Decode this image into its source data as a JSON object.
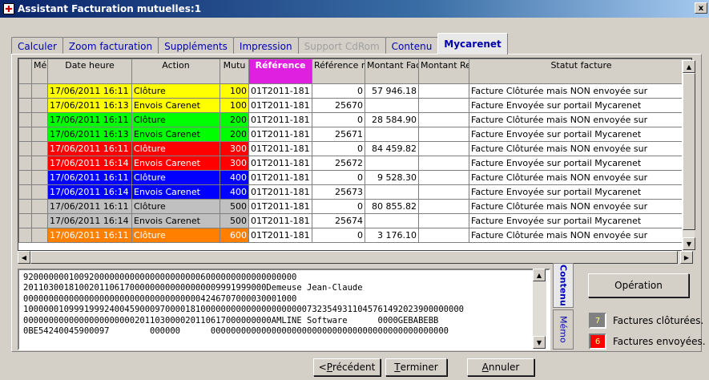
{
  "window": {
    "title": "Assistant Facturation mutuelles:1",
    "icon": "app-cross-icon",
    "close": "x"
  },
  "tabs": [
    {
      "label": "Calculer",
      "state": "normal"
    },
    {
      "label": "Zoom facturation",
      "state": "normal"
    },
    {
      "label": "Suppléments",
      "state": "normal"
    },
    {
      "label": "Impression",
      "state": "normal"
    },
    {
      "label": "Support CdRom",
      "state": "disabled"
    },
    {
      "label": "Contenu",
      "state": "normal"
    },
    {
      "label": "Mycarenet",
      "state": "active"
    }
  ],
  "grid": {
    "headers": [
      "Mé mo",
      "Date heure",
      "Action",
      "Mutu",
      "Référence",
      "Référence retounée",
      "Montant Facture",
      "Montant Rejeté",
      "Statut facture"
    ],
    "rows": [
      {
        "date": "17/06/2011 16:11",
        "action": "Clôture",
        "mutu": "100",
        "ref": "01T2011-181",
        "ref_ret": "0",
        "montant": "57 946.18",
        "rejete": "",
        "statut": "Facture Clôturée mais NON envoyée sur",
        "color": "#ffff00",
        "text": "#000000"
      },
      {
        "date": "17/06/2011 16:13",
        "action": "Envois Carenet",
        "mutu": "100",
        "ref": "01T2011-181",
        "ref_ret": "25670",
        "montant": "",
        "rejete": "",
        "statut": "Facture Envoyée sur portail Mycarenet",
        "color": "#ffff00",
        "text": "#000000"
      },
      {
        "date": "17/06/2011 16:11",
        "action": "Clôture",
        "mutu": "200",
        "ref": "01T2011-181",
        "ref_ret": "0",
        "montant": "28 584.90",
        "rejete": "",
        "statut": "Facture Clôturée mais NON envoyée sur",
        "color": "#00ff00",
        "text": "#000000"
      },
      {
        "date": "17/06/2011 16:13",
        "action": "Envois Carenet",
        "mutu": "200",
        "ref": "01T2011-181",
        "ref_ret": "25671",
        "montant": "",
        "rejete": "",
        "statut": "Facture Envoyée sur portail Mycarenet",
        "color": "#00ff00",
        "text": "#000000"
      },
      {
        "date": "17/06/2011 16:11",
        "action": "Clôture",
        "mutu": "300",
        "ref": "01T2011-181",
        "ref_ret": "0",
        "montant": "84 459.82",
        "rejete": "",
        "statut": "Facture Clôturée mais NON envoyée sur",
        "color": "#ff0000",
        "text": "#ffffff"
      },
      {
        "date": "17/06/2011 16:14",
        "action": "Envois Carenet",
        "mutu": "300",
        "ref": "01T2011-181",
        "ref_ret": "25672",
        "montant": "",
        "rejete": "",
        "statut": "Facture Envoyée sur portail Mycarenet",
        "color": "#ff0000",
        "text": "#ffffff"
      },
      {
        "date": "17/06/2011 16:11",
        "action": "Clôture",
        "mutu": "400",
        "ref": "01T2011-181",
        "ref_ret": "0",
        "montant": "9 528.30",
        "rejete": "",
        "statut": "Facture Clôturée mais NON envoyée sur",
        "color": "#0000ff",
        "text": "#ffffff"
      },
      {
        "date": "17/06/2011 16:14",
        "action": "Envois Carenet",
        "mutu": "400",
        "ref": "01T2011-181",
        "ref_ret": "25673",
        "montant": "",
        "rejete": "",
        "statut": "Facture Envoyée sur portail Mycarenet",
        "color": "#0000ff",
        "text": "#ffffff"
      },
      {
        "date": "17/06/2011 16:11",
        "action": "Clôture",
        "mutu": "500",
        "ref": "01T2011-181",
        "ref_ret": "0",
        "montant": "80 855.82",
        "rejete": "",
        "statut": "Facture Clôturée mais NON envoyée sur",
        "color": "#c0c0c0",
        "text": "#000000"
      },
      {
        "date": "17/06/2011 16:14",
        "action": "Envois Carenet",
        "mutu": "500",
        "ref": "01T2011-181",
        "ref_ret": "25674",
        "montant": "",
        "rejete": "",
        "statut": "Facture Envoyée sur portail Mycarenet",
        "color": "#c0c0c0",
        "text": "#000000"
      },
      {
        "date": "17/06/2011 16:11",
        "action": "Clôture",
        "mutu": "600",
        "ref": "01T2011-181",
        "ref_ret": "0",
        "montant": "3 176.10",
        "rejete": "",
        "statut": "Facture Clôturée mais NON envoyée sur",
        "color": "#ff8000",
        "text": "#ffffff"
      }
    ]
  },
  "content_text": [
    "920000000100920000000000000000000006000000000000000000",
    "201103001810020110617000000000000000009991999000Demeuse Jean-Claude",
    "000000000000000000000000000000000004246707000030001000",
    "100000010999199924004590009700001810000000000000000000007323549311045761492023900000000",
    "0000000000000000000000201103000020110617000000000AMLINE Software      0000GEBABEBB",
    "0BE54240045900097        000000      00000000000000000000000000000000000000000000000"
  ],
  "side_tabs": {
    "contenu": "Contenu",
    "memo": "Mémo"
  },
  "operation_button": "Opération",
  "legend": [
    {
      "count": "7",
      "label": "Factures clôturées.",
      "color": "#808080"
    },
    {
      "count": "6",
      "label": "Factures envoyées.",
      "color": "#ff0000"
    }
  ],
  "nav": {
    "prev_underline": "P",
    "prev_rest": "récédent",
    "prev_prefix": "< ",
    "finish_underline": "T",
    "finish_rest": "erminer",
    "cancel_underline": "A",
    "cancel_rest": "nnuler"
  }
}
